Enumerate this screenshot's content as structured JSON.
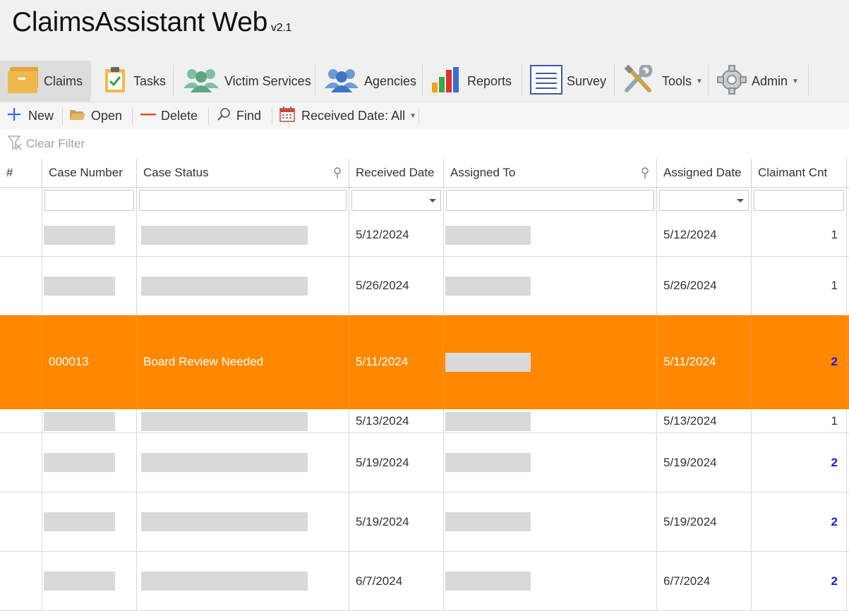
{
  "app": {
    "title": "ClaimsAssistant Web",
    "version": "v2.1"
  },
  "nav": [
    {
      "label": "Claims",
      "icon": "claims-folder-icon",
      "active": true
    },
    {
      "label": "Tasks",
      "icon": "tasks-clipboard-icon"
    },
    {
      "label": "Victim Services",
      "icon": "victim-services-people-icon"
    },
    {
      "label": "Agencies",
      "icon": "agencies-people-icon"
    },
    {
      "label": "Reports",
      "icon": "reports-bar-chart-icon"
    },
    {
      "label": "Survey",
      "icon": "survey-list-icon"
    },
    {
      "label": "Tools",
      "icon": "tools-wrench-icon",
      "dropdown": true
    },
    {
      "label": "Admin",
      "icon": "admin-gear-icon",
      "dropdown": true
    }
  ],
  "toolbar": {
    "new": "New",
    "open": "Open",
    "delete": "Delete",
    "find": "Find",
    "received_filter": "Received Date: All"
  },
  "filter": {
    "clear": "Clear Filter"
  },
  "grid": {
    "columns": [
      "#",
      "Case Number",
      "Case Status",
      "Received Date",
      "Assigned To",
      "Assigned Date",
      "Claimant Cnt"
    ],
    "rows": [
      {
        "case_number": "",
        "case_status": "",
        "received": "5/12/2024",
        "assigned_to": "",
        "assigned": "5/12/2024",
        "count": "1"
      },
      {
        "case_number": "",
        "case_status": "",
        "received": "5/26/2024",
        "assigned_to": "",
        "assigned": "5/26/2024",
        "count": "1"
      },
      {
        "case_number": "000013",
        "case_status": "Board Review Needed",
        "received": "5/11/2024",
        "assigned_to": "",
        "assigned": "5/11/2024",
        "count": "2",
        "selected": true
      },
      {
        "case_number": "",
        "case_status": "",
        "received": "5/13/2024",
        "assigned_to": "",
        "assigned": "5/13/2024",
        "count": "1"
      },
      {
        "case_number": "",
        "case_status": "",
        "received": "5/19/2024",
        "assigned_to": "",
        "assigned": "5/19/2024",
        "count": "2"
      },
      {
        "case_number": "",
        "case_status": "",
        "received": "5/19/2024",
        "assigned_to": "",
        "assigned": "5/19/2024",
        "count": "2"
      },
      {
        "case_number": "",
        "case_status": "",
        "received": "6/7/2024",
        "assigned_to": "",
        "assigned": "6/7/2024",
        "count": "2"
      }
    ]
  },
  "colors": {
    "selected_row": "#ff8800",
    "count_highlight": "#1a1adc"
  }
}
